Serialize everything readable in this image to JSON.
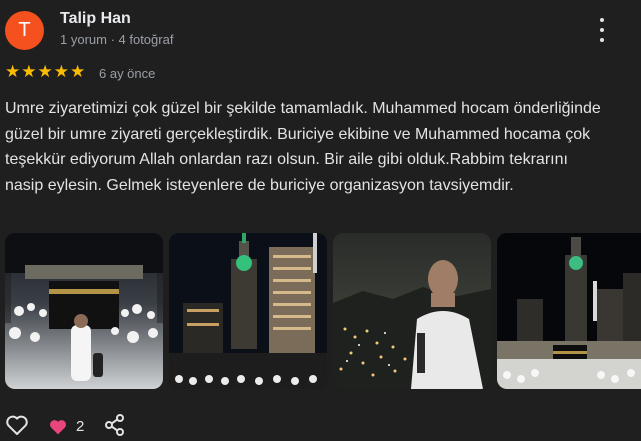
{
  "reviewer": {
    "initial": "T",
    "avatar_color": "#f4511e",
    "name": "Talip Han",
    "meta": "1 yorum · 4 fotoğraf"
  },
  "rating": {
    "stars": 5,
    "star_color": "#fbbc04",
    "time_ago": "6 ay önce"
  },
  "review_text": "Umre ziyaretimizi çok güzel bir şekilde tamamladık. Muhammed hocam önderliğinde güzel bir umre ziyareti gerçekleştirdik. Buriciye ekibine ve Muhammed hocama çok teşekkür ediyorum Allah onlardan razı olsun. Bir aile gibi olduk.Rabbim tekrarını nasip eylesin. Gelmek isteyenlere de buriciye organizasyon tavsiyemdir.",
  "photos": [
    {
      "subject": "kaaba-courtyard-photo"
    },
    {
      "subject": "clock-tower-night-photo"
    },
    {
      "subject": "man-city-night-photo"
    },
    {
      "subject": "kaaba-clock-tower-photo"
    }
  ],
  "actions": {
    "like_icon": "heart-outline-icon",
    "reaction_icon": "heart-filled-icon",
    "reaction_color": "#e8457c",
    "reaction_count": "2",
    "share_icon": "share-icon"
  }
}
